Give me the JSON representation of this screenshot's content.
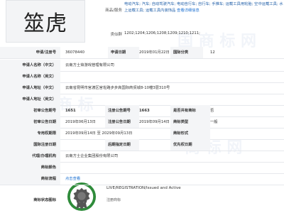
{
  "mark": {
    "text": "筮虎"
  },
  "top": {
    "goods_label": "商品/服务",
    "goods_value": "电动汽车; 汽车; 自动驾驶汽车; 电动自行车; 自行车; 手推车; 运载工具用轮胎; 空中运载工具; 水上运载工具; 运载工具内装饰品",
    "goods_link": "查看详细信息",
    "group_label": "类似群",
    "group_value": "1202;1204;1206;1208;1209;1210;1211;"
  },
  "rows": {
    "app_no_label": "申请/注册号",
    "app_no": "36078440",
    "app_date_label": "申请日期",
    "app_date": "2019年01月22日",
    "intl_class_label": "国际分类",
    "intl_class": "12",
    "applicant_cn_label": "申请人名称（中文）",
    "applicant_cn": "云南方士茹游戏管理有限公司",
    "applicant_en_label": "申请人名称（英文）",
    "applicant_en": "",
    "addr_cn_label": "申请人地址（中文）",
    "addr_cn": "云南省昆明市官渡区官佐路步步高国际商贸城8-10幢3层310号",
    "addr_en_label": "申请人地址（英文）",
    "addr_en": "",
    "prelim_no_label": "初审公告期号",
    "prelim_no": "1651",
    "reg_no_label": "注册公告期号",
    "reg_no": "1663",
    "shared_label": "是否共有商标",
    "shared": "否",
    "prelim_date_label": "初审公告日期",
    "prelim_date": "2019年06月13日",
    "reg_date_label": "注册公告日期",
    "reg_date": "2019年09月14日",
    "type_label": "商标类型",
    "type": "一般",
    "exclusive_label": "专用权期限",
    "exclusive": "2019年09月14日 至 2029年09月13日",
    "form_label": "商标形式",
    "form": "",
    "intl_reg_label": "国际注册日期",
    "intl_reg": "",
    "later_label": "后期指定日期",
    "later": "",
    "priority_label": "优先权日期",
    "priority": "",
    "agent_label": "代理/办理机构",
    "agent": "云南方士企业集团股份有限公司",
    "color_label": "商标颜色",
    "color": "",
    "process_label": "商标流程",
    "process_link": "点击查看"
  },
  "status": {
    "label": "商标状态图标",
    "text": "LIVE/REGISTRATION/Issued and Active",
    "sub": "注册商标",
    "color": "#2e8b3a"
  }
}
